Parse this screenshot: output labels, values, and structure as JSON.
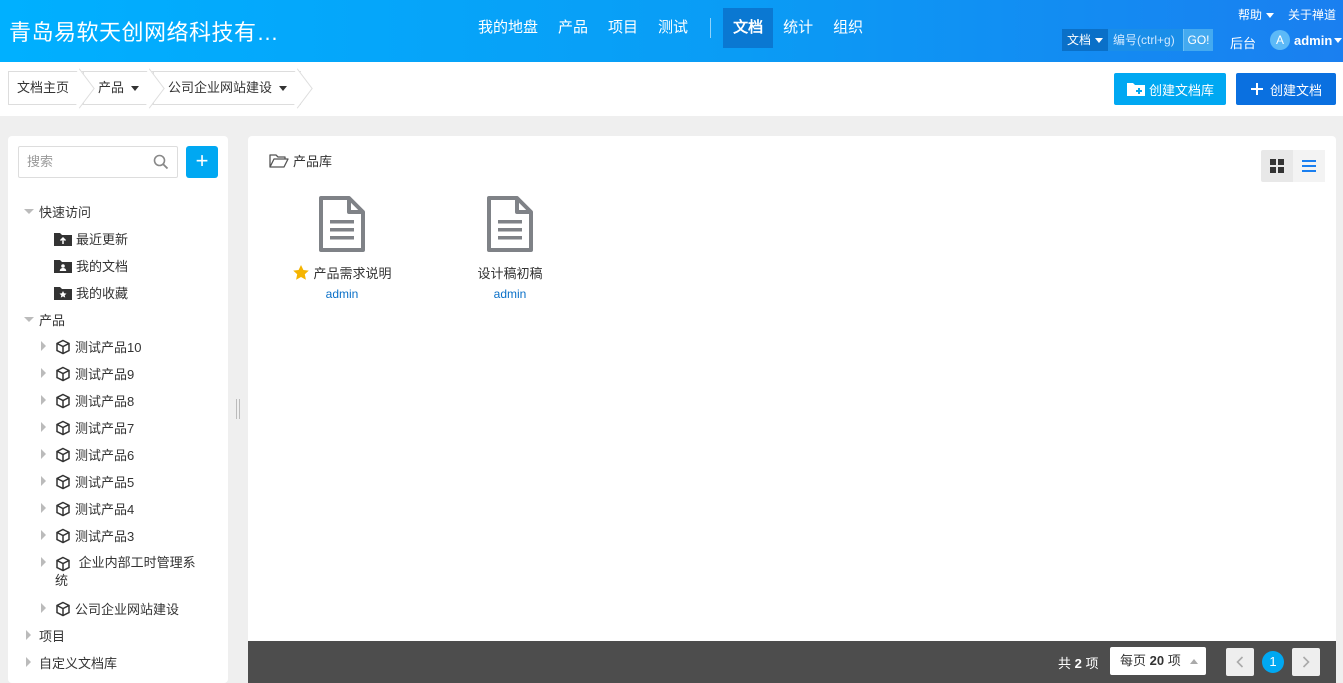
{
  "header": {
    "company": "青岛易软天创网络科技有…",
    "nav": [
      "我的地盘",
      "产品",
      "项目",
      "测试"
    ],
    "nav_active": "文档",
    "nav_after": [
      "统计",
      "组织"
    ],
    "help": "帮助",
    "about": "关于禅道",
    "search_type": "文档",
    "search_placeholder": "编号(ctrl+g)",
    "search_go": "GO!",
    "admin_link": "后台",
    "avatar_letter": "A",
    "user": "admin"
  },
  "breadcrumb": {
    "home": "文档主页",
    "product": "产品",
    "library": "公司企业网站建设"
  },
  "actions": {
    "create_lib": "创建文档库",
    "create_doc": "创建文档"
  },
  "sidebar": {
    "search_placeholder": "搜索",
    "quick_access": "快速访问",
    "quick_items": [
      "最近更新",
      "我的文档",
      "我的收藏"
    ],
    "products_label": "产品",
    "products": [
      "测试产品10",
      "测试产品9",
      "测试产品8",
      "测试产品7",
      "测试产品6",
      "测试产品5",
      "测试产品4",
      "测试产品3",
      "企业内部工时管理系统",
      "公司企业网站建设"
    ],
    "projects_label": "项目",
    "custom_label": "自定义文档库"
  },
  "main": {
    "lib_title": "产品库",
    "docs": [
      {
        "name": "产品需求说明",
        "author": "admin",
        "starred": true
      },
      {
        "name": "设计稿初稿",
        "author": "admin",
        "starred": false
      }
    ]
  },
  "pager": {
    "total_prefix": "共",
    "total": "2",
    "total_suffix": "项",
    "per_page_prefix": "每页",
    "per_page": "20",
    "per_page_suffix": "项",
    "current_page": "1"
  },
  "colors": {
    "header_start": "#00b0ff",
    "header_end": "#1a7ff0",
    "primary": "#00a8f2",
    "primary_dark": "#0a70e0",
    "footer": "#4d4d4d"
  }
}
